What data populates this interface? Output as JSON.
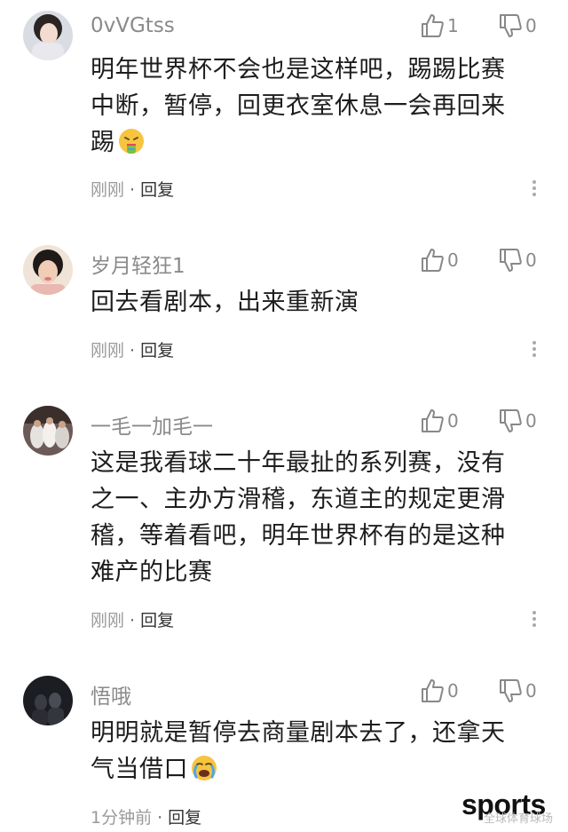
{
  "comments": [
    {
      "username": "0vVGtss",
      "likes": "1",
      "dislikes": "0",
      "lines": [
        "明年世界杯不会也是这样吧，踢踢比赛",
        "中断，暂停，回更衣室休息一会再回来",
        "踢"
      ],
      "emoji": "nauseated-face-emoji",
      "time": "刚刚",
      "reply": "回复"
    },
    {
      "username": "岁月轻狂1",
      "likes": "0",
      "dislikes": "0",
      "lines": [
        "回去看剧本，出来重新演"
      ],
      "time": "刚刚",
      "reply": "回复"
    },
    {
      "username": "一毛一加毛一",
      "likes": "0",
      "dislikes": "0",
      "lines": [
        "这是我看球二十年最扯的系列赛，没有",
        "之一、主办方滑稽，东道主的规定更滑",
        "稽，等着看吧，明年世界杯有的是这种",
        "难产的比赛"
      ],
      "time": "刚刚",
      "reply": "回复"
    },
    {
      "username": "悟哦",
      "likes": "0",
      "dislikes": "0",
      "lines": [
        "明明就是暂停去商量剧本去了，还拿天",
        "气当借口"
      ],
      "emoji": "crying-face-emoji",
      "time": "1分钟前",
      "reply": "回复"
    }
  ],
  "watermark": "sports",
  "watermark_sub": "全球体育球场"
}
